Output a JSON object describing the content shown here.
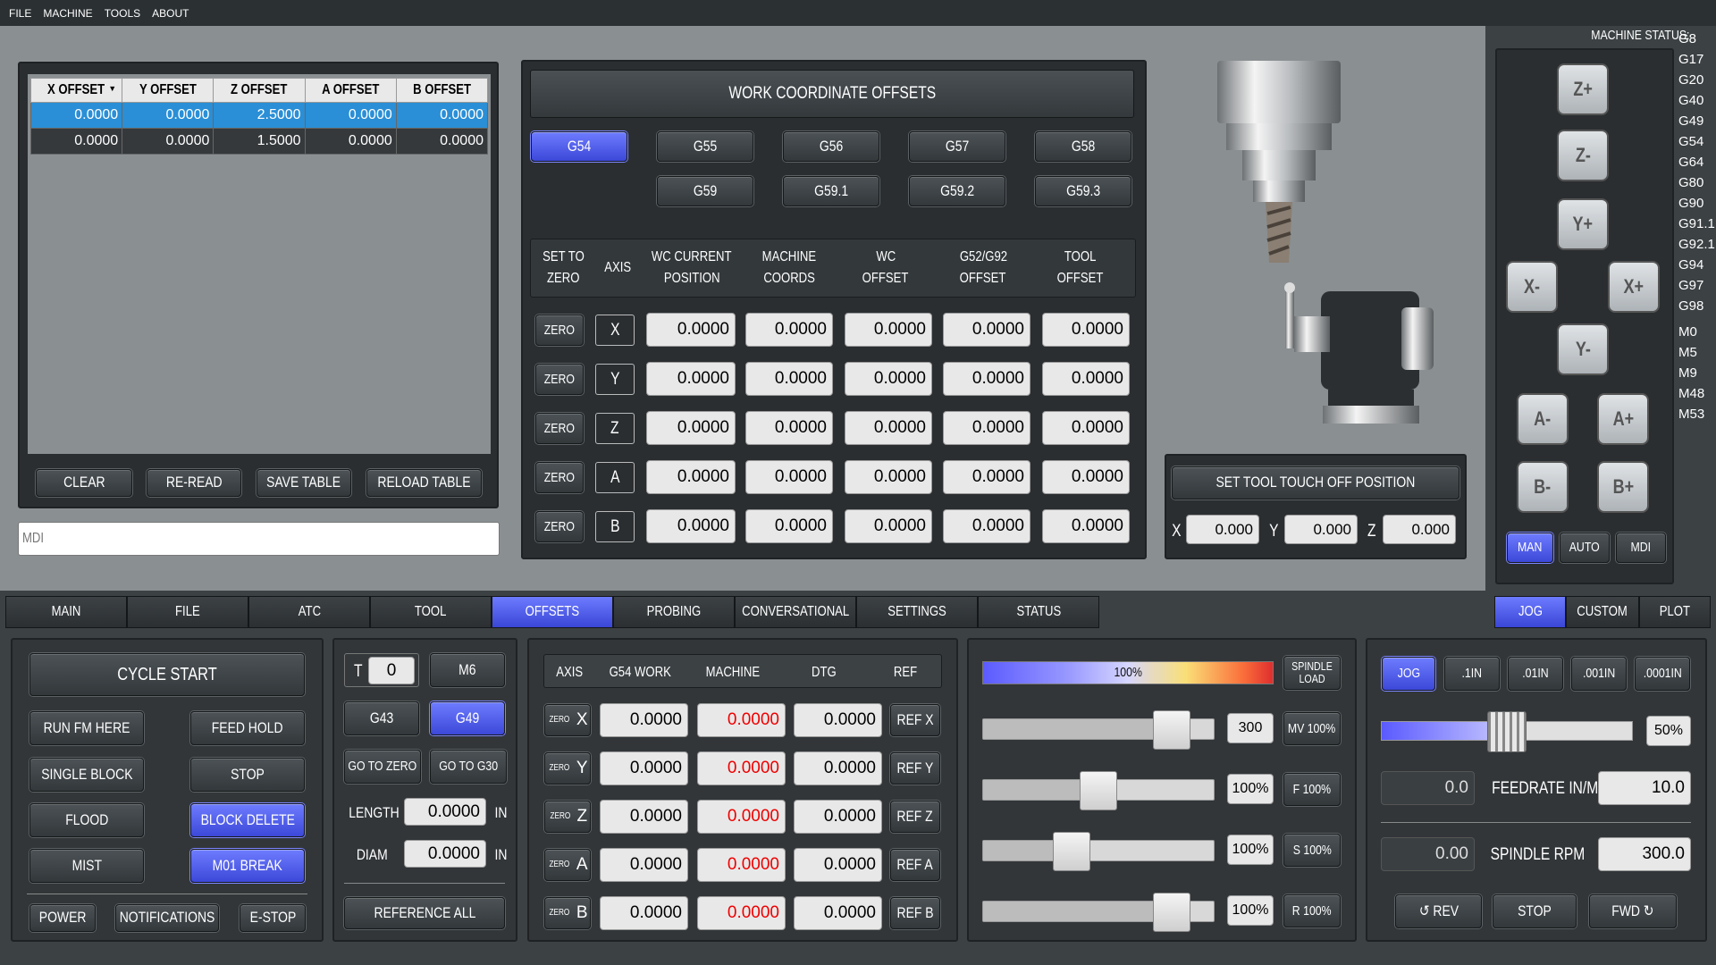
{
  "menu": [
    "FILE",
    "MACHINE",
    "TOOLS",
    "ABOUT"
  ],
  "offset_table": {
    "headers": [
      "X OFFSET",
      "Y OFFSET",
      "Z OFFSET",
      "A OFFSET",
      "B OFFSET"
    ],
    "rows": [
      [
        "0.0000",
        "0.0000",
        "2.5000",
        "0.0000",
        "0.0000"
      ],
      [
        "0.0000",
        "0.0000",
        "1.5000",
        "0.0000",
        "0.0000"
      ]
    ],
    "buttons": [
      "CLEAR",
      "RE-READ",
      "SAVE TABLE",
      "RELOAD TABLE"
    ]
  },
  "mdi": {
    "placeholder": "MDI"
  },
  "wco": {
    "title": "WORK COORDINATE OFFSETS",
    "systems": [
      "G54",
      "G55",
      "G56",
      "G57",
      "G58",
      "G59",
      "G59.1",
      "G59.2",
      "G59.3"
    ],
    "active_system": "G54",
    "headers": [
      [
        "SET TO",
        "ZERO"
      ],
      [
        "AXIS"
      ],
      [
        "WC CURRENT",
        "POSITION"
      ],
      [
        "MACHINE",
        "COORDS"
      ],
      [
        "WC",
        "OFFSET"
      ],
      [
        "G52/G92",
        "OFFSET"
      ],
      [
        "TOOL",
        "OFFSET"
      ]
    ],
    "zero_label": "ZERO",
    "rows": [
      {
        "axis": "X",
        "values": [
          "0.0000",
          "0.0000",
          "0.0000",
          "0.0000",
          "0.0000"
        ]
      },
      {
        "axis": "Y",
        "values": [
          "0.0000",
          "0.0000",
          "0.0000",
          "0.0000",
          "0.0000"
        ]
      },
      {
        "axis": "Z",
        "values": [
          "0.0000",
          "0.0000",
          "0.0000",
          "0.0000",
          "0.0000"
        ]
      },
      {
        "axis": "A",
        "values": [
          "0.0000",
          "0.0000",
          "0.0000",
          "0.0000",
          "0.0000"
        ]
      },
      {
        "axis": "B",
        "values": [
          "0.0000",
          "0.0000",
          "0.0000",
          "0.0000",
          "0.0000"
        ]
      }
    ]
  },
  "touchoff": {
    "button": "SET TOOL TOUCH OFF POSITION",
    "x_label": "X",
    "x": "0.000",
    "y_label": "Y",
    "y": "0.000",
    "z_label": "Z",
    "z": "0.000"
  },
  "status": {
    "title": "MACHINE STATUS:",
    "gcodes": [
      "G8",
      "G17",
      "G20",
      "G40",
      "G49",
      "G54",
      "G64",
      "G80",
      "G90",
      "G91.1",
      "G92.1",
      "G94",
      "G97",
      "G98"
    ],
    "mcodes": [
      "M0",
      "M5",
      "M9",
      "M48",
      "M53"
    ]
  },
  "jog": {
    "buttons": [
      "Z+",
      "Z-",
      "Y+",
      "X-",
      "X+",
      "Y-",
      "A-",
      "A+",
      "B-",
      "B+"
    ],
    "modes": [
      "MAN",
      "AUTO",
      "MDI"
    ],
    "active_mode": "MAN"
  },
  "tabs": [
    "MAIN",
    "FILE",
    "ATC",
    "TOOL",
    "OFFSETS",
    "PROBING",
    "CONVERSATIONAL",
    "SETTINGS",
    "STATUS"
  ],
  "active_tab": "OFFSETS",
  "right_tabs": [
    "JOG",
    "CUSTOM",
    "PLOT"
  ],
  "active_right_tab": "JOG",
  "program": {
    "cycle_start": "CYCLE START",
    "left": [
      "RUN FM HERE",
      "SINGLE BLOCK",
      "FLOOD",
      "MIST"
    ],
    "right": [
      "FEED HOLD",
      "STOP",
      "BLOCK DELETE",
      "M01 BREAK"
    ],
    "bottom": [
      "POWER",
      "NOTIFICATIONS",
      "E-STOP"
    ]
  },
  "tool": {
    "t_label": "T",
    "t_value": "0",
    "m6": "M6",
    "g43": "G43",
    "g49": "G49",
    "go_zero": "GO TO ZERO",
    "go_g30": "GO TO G30",
    "length_label": "LENGTH",
    "length": "0.0000",
    "length_unit": "IN",
    "diam_label": "DIAM",
    "diam": "0.0000",
    "diam_unit": "IN",
    "ref_all": "REFERENCE ALL"
  },
  "dro": {
    "headers": [
      "AXIS",
      "G54 WORK",
      "MACHINE",
      "DTG",
      "REF"
    ],
    "zero_label": "ZERO",
    "rows": [
      {
        "axis": "X",
        "work": "0.0000",
        "machine": "0.0000",
        "dtg": "0.0000",
        "ref": "REF X"
      },
      {
        "axis": "Y",
        "work": "0.0000",
        "machine": "0.0000",
        "dtg": "0.0000",
        "ref": "REF Y"
      },
      {
        "axis": "Z",
        "work": "0.0000",
        "machine": "0.0000",
        "dtg": "0.0000",
        "ref": "REF Z"
      },
      {
        "axis": "A",
        "work": "0.0000",
        "machine": "0.0000",
        "dtg": "0.0000",
        "ref": "REF A"
      },
      {
        "axis": "B",
        "work": "0.0000",
        "machine": "0.0000",
        "dtg": "0.0000",
        "ref": "REF B"
      }
    ]
  },
  "overrides": {
    "load_label": "100%",
    "load_fraction": 0.6,
    "spindle_load_button": "SPINDLE LOAD",
    "rows": [
      {
        "value": "300",
        "button": "MV 100%",
        "level": 0.88
      },
      {
        "value": "100%",
        "button": "F 100%",
        "level": 0.5
      },
      {
        "value": "100%",
        "button": "S 100%",
        "level": 0.36
      },
      {
        "value": "100%",
        "button": "R 100%",
        "level": 0.88
      }
    ]
  },
  "jogpanel": {
    "increments": [
      "JOG",
      ".1IN",
      ".01IN",
      ".001IN",
      ".0001IN"
    ],
    "active_increment": "JOG",
    "rate_label": "50%",
    "rate_level": 0.5,
    "feed_value": "0.0",
    "feed_label": "FEEDRATE IN/M",
    "feed_set": "10.0",
    "spindle_value": "0.00",
    "spindle_label": "SPINDLE RPM",
    "spindle_set": "300.0",
    "rev": "↺ REV",
    "stop": "STOP",
    "fwd": "FWD ↻"
  },
  "colors": {
    "accent": "#4a57ee",
    "background": "#3c4144",
    "panel": "#2a2e31",
    "upper": "#8a8f92"
  }
}
